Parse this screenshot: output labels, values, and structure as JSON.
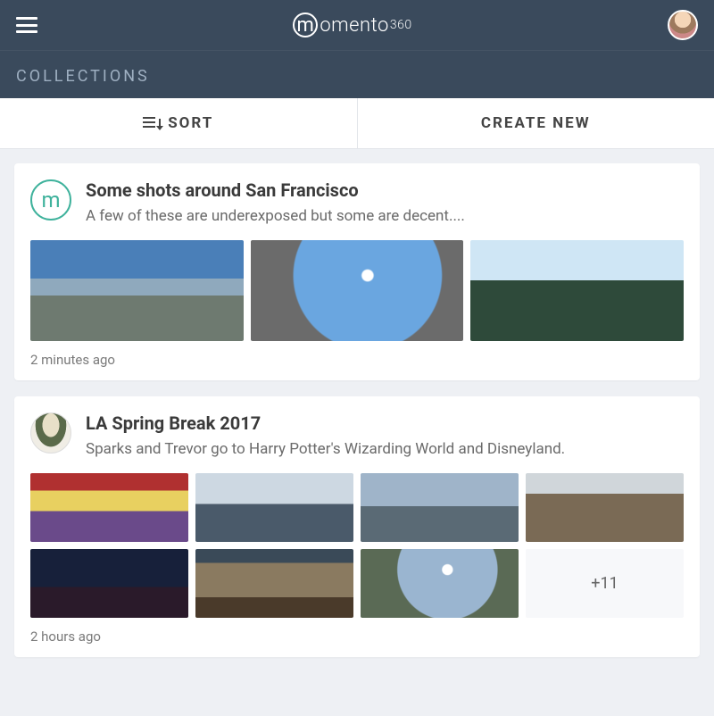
{
  "header": {
    "brand_main": "omento",
    "brand_suffix": "360",
    "brand_mark_letter": "m"
  },
  "subheader": {
    "title": "COLLECTIONS"
  },
  "actions": {
    "sort_label": "SORT",
    "create_label": "CREATE NEW"
  },
  "collections": [
    {
      "avatar_kind": "momento",
      "avatar_letter": "m",
      "title": "Some shots around San Francisco",
      "description": "A few of these are underexposed but some are decent....",
      "timestamp": "2 minutes ago",
      "grid_cols": 3,
      "thumbs": [
        "p-sf1",
        "p-sf2",
        "p-sf3"
      ],
      "more_count": null
    },
    {
      "avatar_kind": "user2",
      "avatar_letter": "",
      "title": "LA Spring Break 2017",
      "description": "Sparks and Trevor go to Harry Potter's Wizarding World and Disneyland.",
      "timestamp": "2 hours ago",
      "grid_cols": 4,
      "thumbs": [
        "p-la1",
        "p-la2",
        "p-la3",
        "p-la4",
        "p-la5",
        "p-la6",
        "p-la7"
      ],
      "more_count": "+11"
    }
  ]
}
